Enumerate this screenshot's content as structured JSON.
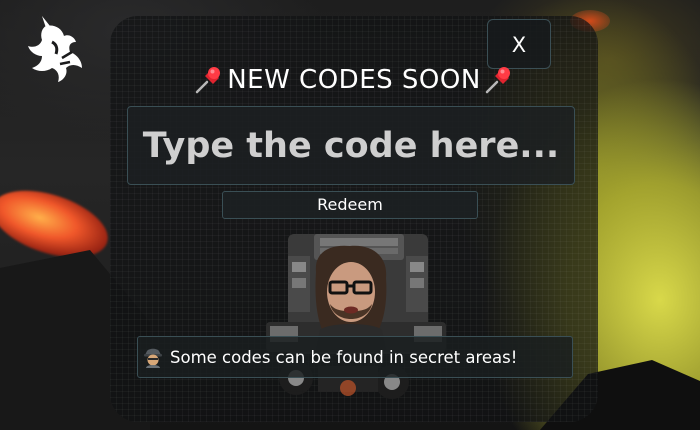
{
  "dialog": {
    "title": "NEW CODES SOON",
    "close_label": "X",
    "input_placeholder": "Type the code here...",
    "input_value": "",
    "redeem_label": "Redeem",
    "hint_text": "Some codes can be found in secret areas!"
  },
  "icons": {
    "logo": "unicorn-logo-icon",
    "title_left": "pushpin-icon",
    "title_right": "pushpin-icon",
    "hint": "detective-icon"
  },
  "colors": {
    "panel_border": "#3a4f55",
    "text": "#ffffff",
    "pin_red": "#e0242f",
    "lava": "#f0572a",
    "yellow_terrain": "#d8d84a"
  }
}
